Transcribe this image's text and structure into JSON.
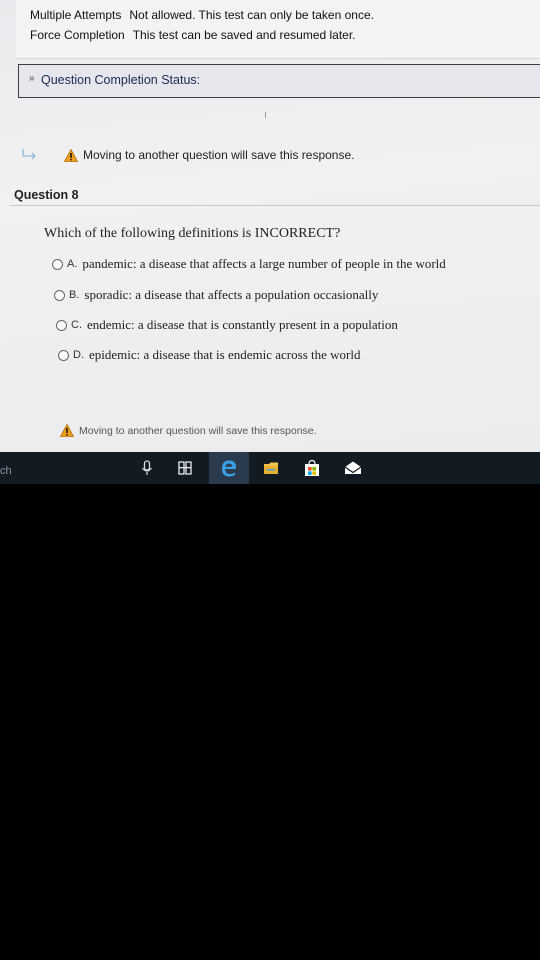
{
  "test_info": {
    "multiple_attempts_label": "Multiple Attempts",
    "multiple_attempts_value": "Not allowed. This test can only be taken once.",
    "force_completion_label": "Force Completion",
    "force_completion_value": "This test can be saved and resumed later."
  },
  "status_bar": {
    "label": "Question Completion Status:",
    "icon": "double-chevron-down-icon"
  },
  "warning_message": "Moving to another question will save this response.",
  "question": {
    "title": "Question 8",
    "prompt": "Which of the following definitions is INCORRECT?",
    "options": [
      {
        "letter": "A.",
        "text": "pandemic: a disease that affects a large number of people in the world"
      },
      {
        "letter": "B.",
        "text": "sporadic: a disease that affects a population occasionally"
      },
      {
        "letter": "C.",
        "text": "endemic: a disease that is constantly present in a population"
      },
      {
        "letter": "D.",
        "text": "epidemic: a disease that is endemic across the world"
      }
    ]
  },
  "taskbar": {
    "search_fragment": "ch",
    "icons": [
      "microphone-icon",
      "task-view-icon",
      "edge-icon",
      "file-explorer-icon",
      "store-icon",
      "mail-icon"
    ]
  },
  "colors": {
    "page_background": "#eeeef0",
    "status_bar_border": "#3a3f4a",
    "warning": "#f0a020",
    "taskbar": "#121a22",
    "edge": "#3aa0e8"
  }
}
